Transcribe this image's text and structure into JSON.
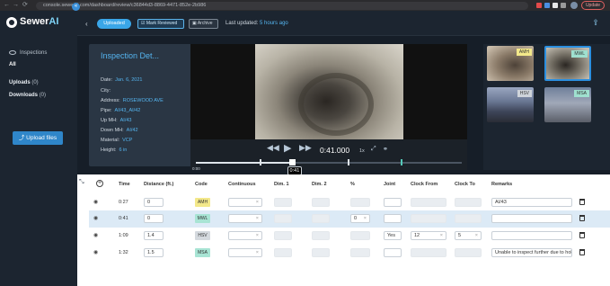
{
  "browser": {
    "url": "console.sewerai.com/dashboard/review/c36844d3-8869-4471-852e-2b986",
    "update_label": "Update",
    "nav_back": "←",
    "nav_forward": "→",
    "nav_reload": "⟳"
  },
  "sidebar": {
    "brand_pre": "Sewer",
    "brand_post": "AI",
    "collapse_label": "«",
    "section": "Inspections",
    "items": [
      {
        "label": "All",
        "count": ""
      },
      {
        "label": "Uploads",
        "count": "(0)"
      },
      {
        "label": "Downloads",
        "count": "(0)"
      }
    ],
    "upload_label": "Upload files",
    "upload_icon": "⤴"
  },
  "header": {
    "back": "‹",
    "status": "Uploaded",
    "mark_reviewed": "Mark Reviewed",
    "archive": "Archive",
    "last_updated_label": "Last updated:",
    "last_updated_value": "5 hours ago",
    "upload_icon": "⇪"
  },
  "details": {
    "title": "Inspection Det...",
    "edit_icon": "✎",
    "rows": [
      {
        "label": "Date:",
        "value": "Jan. 6, 2021"
      },
      {
        "label": "City:",
        "value": ""
      },
      {
        "label": "Address:",
        "value": "ROSEWOOD AVE"
      },
      {
        "label": "Pipe:",
        "value": "AI/43_AI/42"
      },
      {
        "label": "Up MH:",
        "value": "AI/43"
      },
      {
        "label": "Down MH:",
        "value": "AI/42"
      },
      {
        "label": "Material:",
        "value": "VCP"
      },
      {
        "label": "Height:",
        "value": "6 in"
      }
    ]
  },
  "player": {
    "rewind": "◀◀",
    "play": "▶",
    "forward": "▶▶",
    "time": "0:41.000",
    "speed": "1x",
    "expand_icon": "⤢",
    "link_icon": "⚭",
    "progress": 0.36,
    "markers": [
      0.24,
      0.36,
      0.57,
      0.77
    ],
    "start_label": "0:00",
    "current_label": "0:41"
  },
  "thumbnails": [
    {
      "code": "AMH",
      "color": "#f3e88a"
    },
    {
      "code": "MWL",
      "color": "#9fe0cf",
      "selected": true
    },
    {
      "code": "HSV",
      "color": "#cfd4da"
    },
    {
      "code": "MSA",
      "color": "#9fe0cf"
    }
  ],
  "table": {
    "expand_icon": "⤡",
    "headers": [
      "Time",
      "Distance (ft.)",
      "Code",
      "Continuous",
      "Dim. 1",
      "Dim. 2",
      "%",
      "Joint",
      "Clock From",
      "Clock To",
      "Remarks"
    ],
    "rows": [
      {
        "time": "0:27",
        "distance": "0",
        "code": "AMH",
        "code_color": "#f3e88a",
        "percent": "",
        "joint": "",
        "clock_from": "",
        "clock_to": "",
        "remarks": "AI/43"
      },
      {
        "time": "0:41",
        "distance": "0",
        "code": "MWL",
        "code_color": "#a8e4d4",
        "percent": "0",
        "joint": "",
        "clock_from": "",
        "clock_to": "",
        "remarks": ""
      },
      {
        "time": "1:09",
        "distance": "1.4",
        "code": "HSV",
        "code_color": "#d4d9de",
        "percent": "",
        "joint": "Yes",
        "clock_from": "12",
        "clock_to": "5",
        "remarks": ""
      },
      {
        "time": "1:32",
        "distance": "1.5",
        "code": "MSA",
        "code_color": "#a8e4d4",
        "percent": "",
        "joint": "",
        "clock_from": "",
        "clock_to": "",
        "remarks": "Unable to inspect further due to hole"
      }
    ],
    "clear_mark": "×",
    "row_icon": "◉"
  }
}
